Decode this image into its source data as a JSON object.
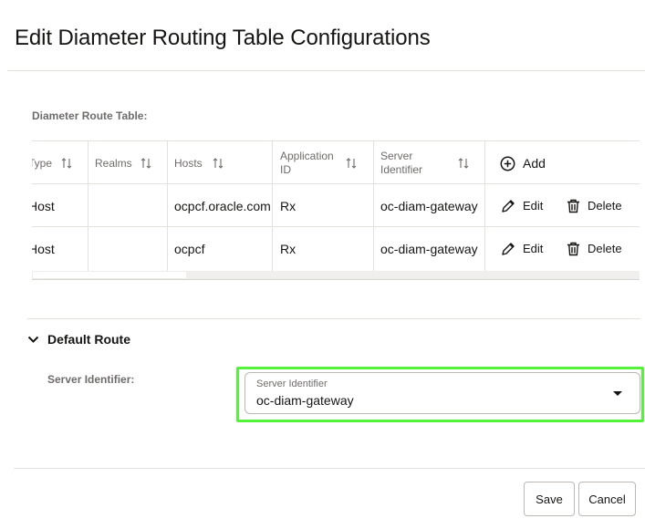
{
  "page": {
    "title": "Edit Diameter Routing Table Configurations"
  },
  "route_table": {
    "label": "Diameter Route Table:",
    "columns": [
      {
        "label": "Type",
        "sortable": true
      },
      {
        "label": "Realms",
        "sortable": true
      },
      {
        "label": "Hosts",
        "sortable": true
      },
      {
        "label": "Application ID",
        "sortable": true
      },
      {
        "label": "Server Identifier",
        "sortable": true
      }
    ],
    "add_label": "Add",
    "rows": [
      {
        "type": "Host",
        "realms": "",
        "hosts": "ocpcf.oracle.com",
        "application_id": "Rx",
        "server_identifier": "oc-diam-gateway",
        "edit_label": "Edit",
        "delete_label": "Delete"
      },
      {
        "type": "Host",
        "realms": "",
        "hosts": "ocpcf",
        "application_id": "Rx",
        "server_identifier": "oc-diam-gateway",
        "edit_label": "Edit",
        "delete_label": "Delete"
      }
    ]
  },
  "default_route": {
    "label": "Default Route",
    "expanded": true,
    "server_identifier_label": "Server Identifier:",
    "select": {
      "floating_label": "Server Identifier",
      "value": "oc-diam-gateway"
    }
  },
  "footer": {
    "save_label": "Save",
    "cancel_label": "Cancel"
  },
  "colors": {
    "highlight": "#55f23b",
    "text": "#161513",
    "muted": "#6f6c69"
  }
}
